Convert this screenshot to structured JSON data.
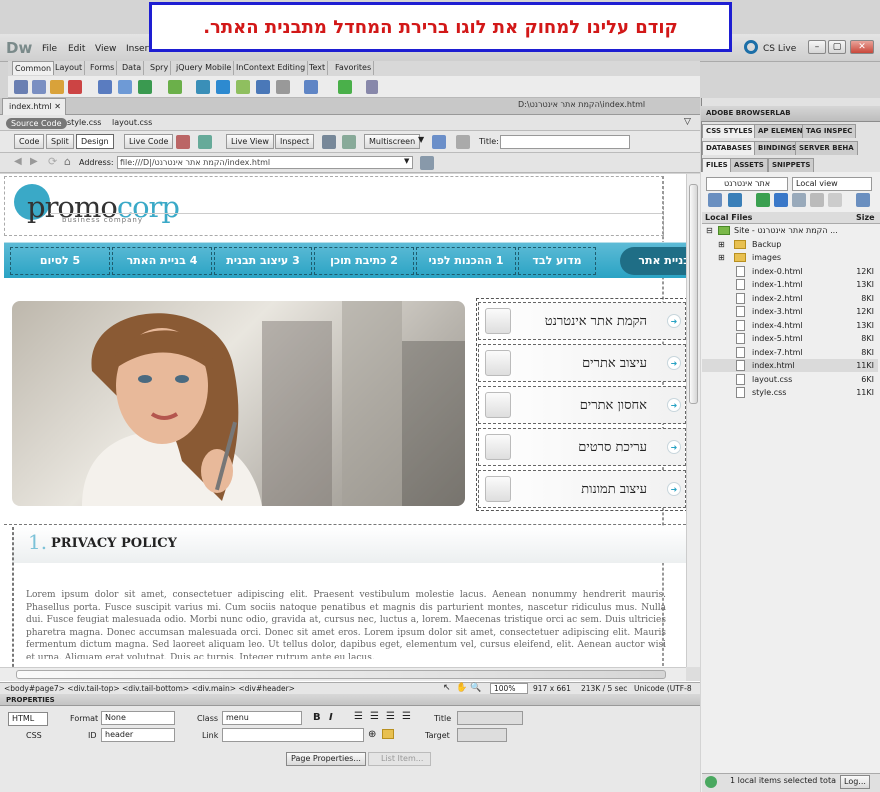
{
  "callout": {
    "text": "קודם עלינו למחוק את לוגו ברירת המחדל מתבנית האתר."
  },
  "app": {
    "logo": "Dw",
    "cs_live": "CS Live"
  },
  "menu": [
    "File",
    "Edit",
    "View",
    "Insert"
  ],
  "insert_tabs": [
    "Common",
    "Layout",
    "Forms",
    "Data",
    "Spry",
    "jQuery Mobile",
    "InContext Editing",
    "Text",
    "Favorites"
  ],
  "document": {
    "tab": "index.html",
    "path": "D:\\הקמת אתר אינטרנט\\index.html",
    "related": {
      "source": "Source Code",
      "files": [
        "style.css",
        "layout.css"
      ]
    },
    "view_buttons": {
      "code": "Code",
      "split": "Split",
      "design": "Design",
      "live_code": "Live Code",
      "live_view": "Live View",
      "inspect": "Inspect",
      "multiscreen": "Multiscreen",
      "title_label": "Title:",
      "title_value": ""
    },
    "address_label": "Address:",
    "address": "file:///D|/הקמת אתר אינטרנט/index.html"
  },
  "site": {
    "logo_a": "promo",
    "logo_b": "corp",
    "logo_tagline": "business company",
    "nav": {
      "active": "בניית אתר",
      "items": [
        "מדוע לבד",
        "1 ההכנות לפני",
        "2 כתיבת תוכן",
        "3 עיצוב תבנית",
        "4 בניית האתר",
        "5 לסיום"
      ]
    },
    "side_items": [
      "הקמת אתר אינטרנט",
      "עיצוב אתרים",
      "אחסון אתרים",
      "עריכת סרטים",
      "עיצוב תמונות"
    ],
    "section_num": "1.",
    "section_title": "PRIVACY POLICY",
    "lorem": "Lorem ipsum dolor sit amet, consectetuer adipiscing elit. Praesent vestibulum molestie lacus. Aenean nonummy hendrerit mauris. Phasellus porta. Fusce suscipit varius mi. Cum sociis natoque penatibus et magnis dis parturient montes, nascetur ridiculus mus. Nulla dui. Fusce feugiat malesuada odio. Morbi nunc odio, gravida at, cursus nec, luctus a, lorem. Maecenas tristique orci ac sem. Duis ultricies pharetra magna. Donec accumsan malesuada orci. Donec sit amet eros. Lorem ipsum dolor sit amet, consectetuer adipiscing elit. Mauris fermentum dictum magna. Sed laoreet aliquam leo. Ut tellus dolor, dapibus eget, elementum vel, cursus eleifend, elit. Aenean auctor wisi et urna. Aliquam erat volutpat. Duis ac turpis. Integer rutrum ante eu lacus."
  },
  "status": {
    "tags": "<body#page7> <div.tail-top> <div.tail-bottom> <div.main> <div#header>",
    "zoom": "100%",
    "dims": "917 x 661",
    "size": "213K / 5 sec",
    "encoding": "Unicode (UTF-8"
  },
  "properties": {
    "title": "PROPERTIES",
    "html": "HTML",
    "css": "CSS",
    "format_label": "Format",
    "format_value": "None",
    "class_label": "Class",
    "class_value": "menu",
    "id_label": "ID",
    "id_value": "header",
    "link_label": "Link",
    "title_label": "Title",
    "target_label": "Target",
    "page_props": "Page Properties...",
    "list_item": "List Item..."
  },
  "right_panel": {
    "browserlab": "ADOBE BROWSERLAB",
    "tabs1": [
      "CSS STYLES",
      "AP ELEMENT",
      "TAG INSPEC"
    ],
    "tabs2": [
      "DATABASES",
      "BINDINGS",
      "SERVER BEHA"
    ],
    "tabs3": [
      "FILES",
      "ASSETS",
      "SNIPPETS"
    ],
    "site_select": "אתר אינטרנט",
    "view_select": "Local view",
    "col_name": "Local Files",
    "col_size": "Size",
    "root": "Site - הקמת אתר אינטרנט ...",
    "folders": [
      "Backup",
      "images"
    ],
    "files": [
      {
        "name": "index-0.html",
        "size": "12KI"
      },
      {
        "name": "index-1.html",
        "size": "13KI"
      },
      {
        "name": "index-2.html",
        "size": "8KI"
      },
      {
        "name": "index-3.html",
        "size": "12KI"
      },
      {
        "name": "index-4.html",
        "size": "13KI"
      },
      {
        "name": "index-5.html",
        "size": "8KI"
      },
      {
        "name": "index-7.html",
        "size": "8KI"
      },
      {
        "name": "index.html",
        "size": "11KI"
      },
      {
        "name": "layout.css",
        "size": "6KI"
      },
      {
        "name": "style.css",
        "size": "11KI"
      }
    ],
    "footer": "1 local items selected tota",
    "log_btn": "Log..."
  }
}
